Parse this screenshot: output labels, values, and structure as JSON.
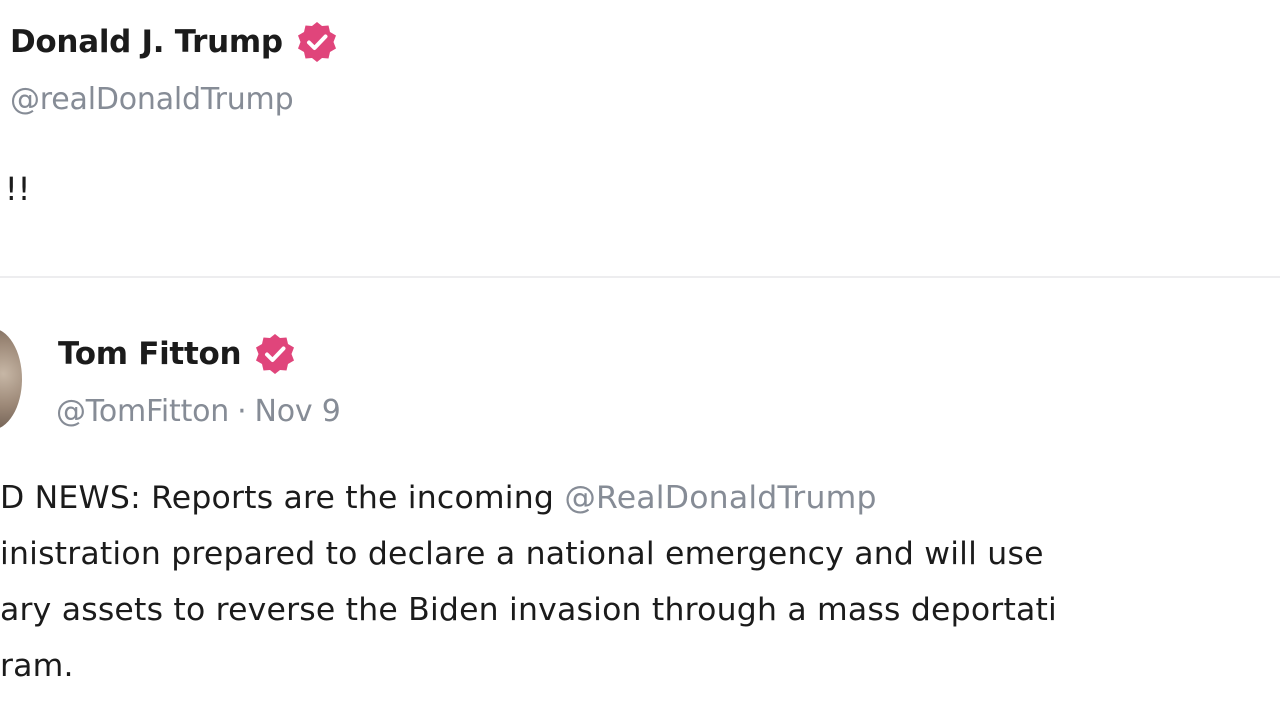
{
  "post": {
    "author_name": "Donald J. Trump",
    "author_handle": "@realDonaldTrump",
    "body": "!!!"
  },
  "quoted_post": {
    "author_name": "Tom Fitton",
    "author_handle": "@TomFitton",
    "separator": "·",
    "date": "Nov 9",
    "lines": [
      {
        "text": "D NEWS: Reports are the incoming ",
        "mention": "@RealDonaldTrump"
      },
      {
        "text": "inistration prepared to declare a national emergency and will use"
      },
      {
        "text": "ary assets to reverse the Biden invasion through a mass deportati"
      },
      {
        "text": "ram."
      }
    ]
  },
  "icons": {
    "verified": "verified-badge-icon"
  },
  "colors": {
    "verified_badge": "#e0457b",
    "handle": "#868c96",
    "text": "#1b1b1b",
    "divider": "#ededef"
  }
}
